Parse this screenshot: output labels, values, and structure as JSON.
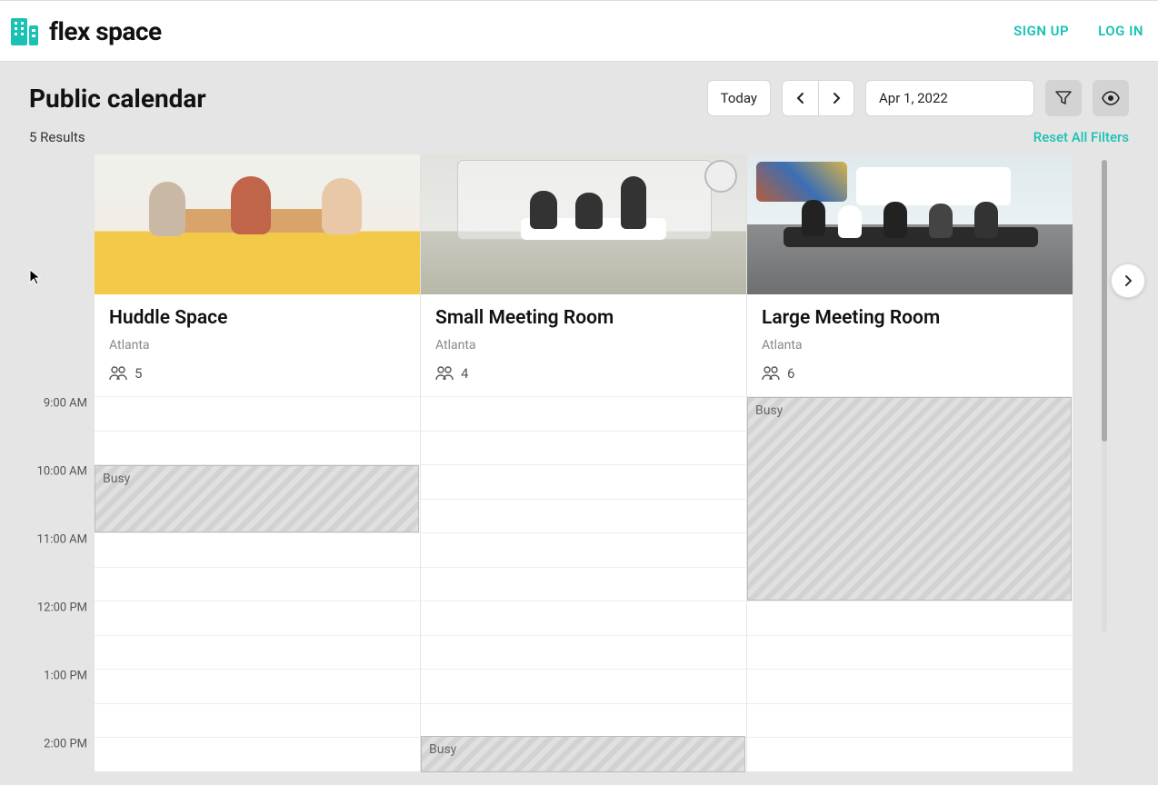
{
  "brand": {
    "name": "flex space"
  },
  "nav": {
    "signup": "SIGN UP",
    "login": "LOG IN"
  },
  "page": {
    "title": "Public calendar",
    "results": "5 Results",
    "reset": "Reset All Filters"
  },
  "toolbar": {
    "today": "Today",
    "date": "Apr 1, 2022"
  },
  "rooms": [
    {
      "name": "Huddle Space",
      "location": "Atlanta",
      "capacity": "5"
    },
    {
      "name": "Small Meeting Room",
      "location": "Atlanta",
      "capacity": "4"
    },
    {
      "name": "Large Meeting Room",
      "location": "Atlanta",
      "capacity": "6"
    }
  ],
  "times": [
    "9:00 AM",
    "10:00 AM",
    "11:00 AM",
    "12:00 PM",
    "1:00 PM",
    "2:00 PM"
  ],
  "events": {
    "busy_label": "Busy",
    "items": [
      {
        "room": 0,
        "start": "10:00 AM",
        "end": "11:00 AM"
      },
      {
        "room": 1,
        "start": "2:00 PM",
        "end": "3:00 PM"
      },
      {
        "room": 2,
        "start": "9:00 AM",
        "end": "12:00 PM"
      }
    ]
  }
}
